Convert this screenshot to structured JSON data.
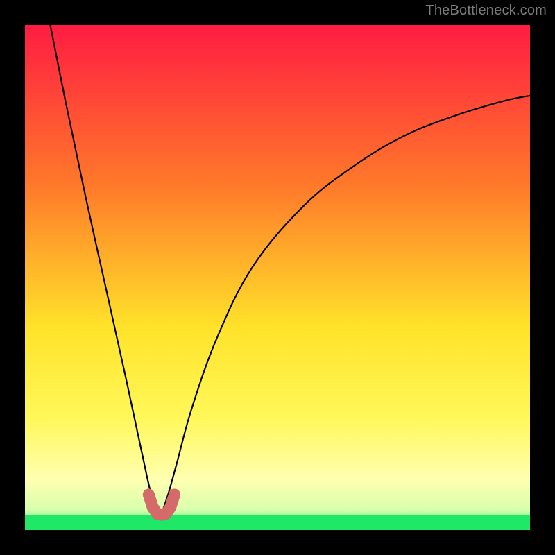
{
  "attribution": "TheBottleneck.com",
  "colors": {
    "black": "#000000",
    "red_top": "#ff1c42",
    "orange": "#ff7a2a",
    "yellow": "#fff02a",
    "pale_yellow": "#ffffb0",
    "green": "#1ee865",
    "curve": "#000000",
    "marker": "#d46a6a"
  },
  "chart_data": {
    "type": "line",
    "title": "",
    "xlabel": "",
    "ylabel": "",
    "xlim": [
      0,
      100
    ],
    "ylim": [
      0,
      100
    ],
    "note": "x is horizontal position (% of plot width); y is vertical height above bottom (% of plot height). Curve is a V-shaped bottleneck dip, minimum near x≈27.",
    "series": [
      {
        "name": "bottleneck-curve",
        "x": [
          5,
          8,
          12,
          16,
          20,
          23,
          25,
          26.5,
          28,
          30,
          33,
          38,
          45,
          55,
          65,
          75,
          85,
          95,
          100
        ],
        "y": [
          100,
          85,
          66,
          48,
          30,
          16,
          7,
          3,
          6,
          13,
          24,
          38,
          52,
          64,
          72,
          78,
          82,
          85,
          86
        ]
      }
    ],
    "markers": {
      "name": "bottleneck-minimum",
      "shape": "u",
      "x": [
        24.5,
        25.3,
        26.2,
        27.0,
        27.9,
        28.8,
        29.6
      ],
      "y": [
        7.0,
        4.5,
        3.2,
        3.0,
        3.2,
        4.5,
        7.0
      ]
    },
    "green_band_y": 3.0
  }
}
